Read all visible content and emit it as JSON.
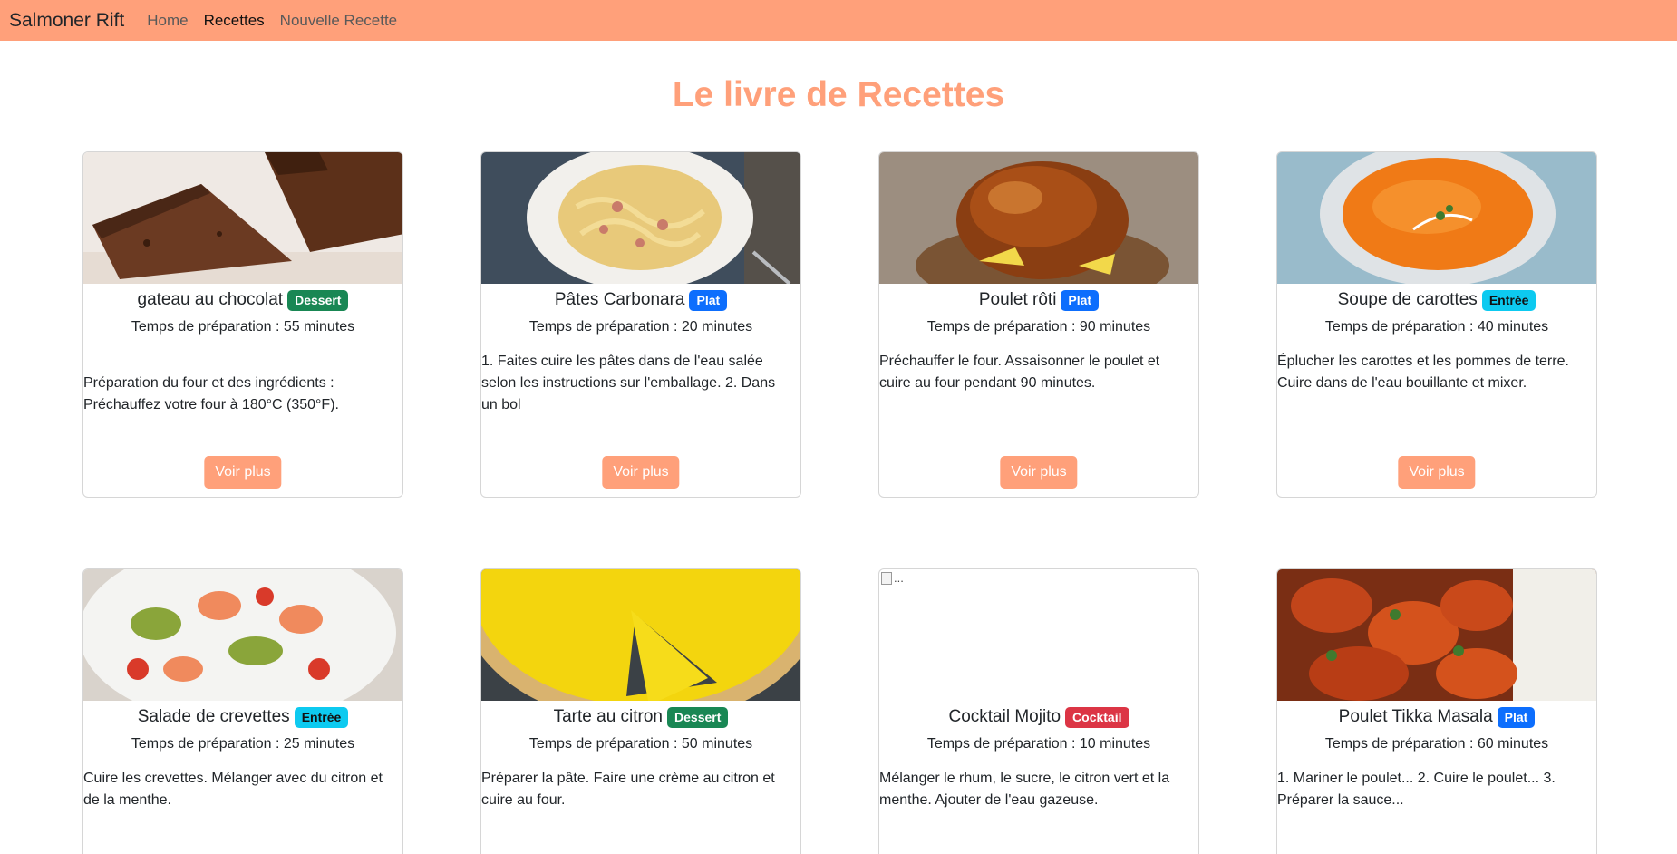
{
  "nav": {
    "brand": "Salmoner Rift",
    "links": [
      "Home",
      "Recettes",
      "Nouvelle Recette"
    ]
  },
  "page": {
    "title": "Le livre de Recettes"
  },
  "colors": {
    "accent": "#ffa07a",
    "dessert": "#198754",
    "plat": "#0d6efd",
    "entree": "#0dcaf0",
    "cocktail": "#dc3545"
  },
  "button_label": "Voir plus",
  "recipes": [
    {
      "name": "gateau au chocolat",
      "category": "Dessert",
      "prep": "Temps de préparation : 55 minutes",
      "desc": "Préparation du four et des ingrédients : Préchauffez votre four à 180°C (350°F).",
      "image": "chocolate-cake-photo"
    },
    {
      "name": "Pâtes Carbonara",
      "category": "Plat",
      "prep": "Temps de préparation : 20 minutes",
      "desc": "1. Faites cuire les pâtes dans de l'eau salée selon les instructions sur l'emballage. 2. Dans un bol",
      "image": "carbonara-photo"
    },
    {
      "name": "Poulet rôti",
      "category": "Plat",
      "prep": "Temps de préparation : 90 minutes",
      "desc": "Préchauffer le four. Assaisonner le poulet et cuire au four pendant 90 minutes.",
      "image": "roast-chicken-photo"
    },
    {
      "name": "Soupe de carottes",
      "category": "Entrée",
      "prep": "Temps de préparation : 40 minutes",
      "desc": "Éplucher les carottes et les pommes de terre. Cuire dans de l'eau bouillante et mixer.",
      "image": "carrot-soup-photo"
    },
    {
      "name": "Salade de crevettes",
      "category": "Entrée",
      "prep": "Temps de préparation : 25 minutes",
      "desc": "Cuire les crevettes. Mélanger avec du citron et de la menthe.",
      "image": "shrimp-salad-photo"
    },
    {
      "name": "Tarte au citron",
      "category": "Dessert",
      "prep": "Temps de préparation : 50 minutes",
      "desc": "Préparer la pâte. Faire une crème au citron et cuire au four.",
      "image": "lemon-tart-photo"
    },
    {
      "name": "Cocktail Mojito",
      "category": "Cocktail",
      "prep": "Temps de préparation : 10 minutes",
      "desc": "Mélanger le rhum, le sucre, le citron vert et la menthe. Ajouter de l'eau gazeuse.",
      "image": "broken-image",
      "image_alt": "..."
    },
    {
      "name": "Poulet Tikka Masala",
      "category": "Plat",
      "prep": "Temps de préparation : 60 minutes",
      "desc": "1. Mariner le poulet... 2. Cuire le poulet... 3. Préparer la sauce...",
      "image": "tikka-masala-photo"
    }
  ]
}
